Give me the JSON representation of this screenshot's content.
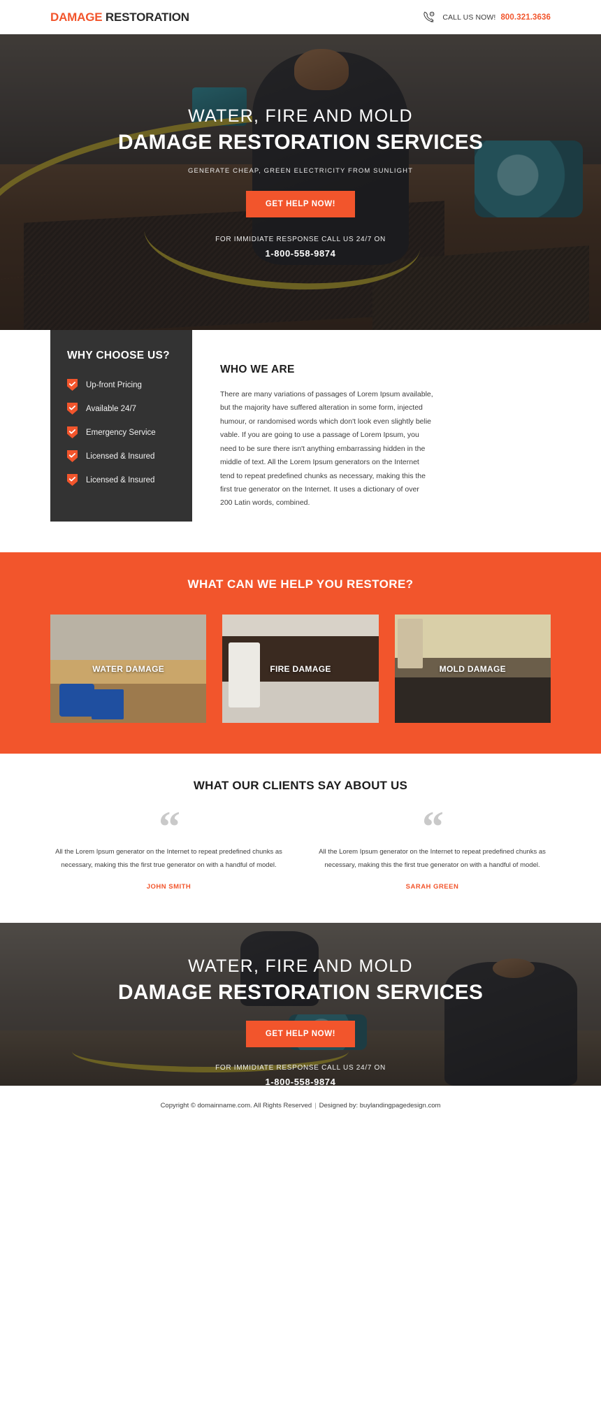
{
  "header": {
    "logo_accent": "DAMAGE",
    "logo_rest": " RESTORATION",
    "phone_icon": "phone-24h-icon",
    "call_label": "CALL US NOW!",
    "call_number": "800.321.3636"
  },
  "hero": {
    "subtitle": "WATER, FIRE AND MOLD",
    "title": "DAMAGE RESTORATION SERVICES",
    "tagline": "GENERATE CHEAP, GREEN ELECTRICITY FROM SUNLIGHT",
    "cta_label": "GET HELP NOW!",
    "call_text": "FOR IMMIDIATE RESPONSE CALL US 24/7 ON",
    "call_number": "1-800-558-9874"
  },
  "why_choose": {
    "title": "WHY CHOOSE US?",
    "icon": "check-shield-icon",
    "items": [
      {
        "label": "Up-front Pricing"
      },
      {
        "label": "Available 24/7"
      },
      {
        "label": "Emergency Service"
      },
      {
        "label": "Licensed & Insured"
      },
      {
        "label": "Licensed & Insured"
      }
    ]
  },
  "who_we_are": {
    "title": "WHO WE ARE",
    "body": "There are many variations of passages of Lorem Ipsum available, but the majority have suffered alteration in some form, injected humour, or randomised words which don't look even slightly belie vable. If you are going to use a passage of Lorem Ipsum, you need to be sure there isn't anything embarrassing hidden in the middle of text. All the Lorem Ipsum generators on the Internet tend to repeat predefined chunks as necessary, making this the first true generator on the Internet. It uses a dictionary of over 200 Latin words, combined."
  },
  "services": {
    "title": "WHAT CAN WE HELP YOU RESTORE?",
    "cards": [
      {
        "label": "WATER DAMAGE",
        "image": "water-damage-photo"
      },
      {
        "label": "FIRE DAMAGE",
        "image": "fire-damage-photo"
      },
      {
        "label": "MOLD DAMAGE",
        "image": "mold-damage-photo"
      }
    ]
  },
  "testimonials": {
    "title": "WHAT OUR CLIENTS SAY ABOUT US",
    "quote_glyph": "“",
    "items": [
      {
        "text": "All the Lorem Ipsum generator on the Internet to repeat predefined chunks as necessary, making this the first true generator on with a handful of model.",
        "name": "JOHN SMITH"
      },
      {
        "text": "All the Lorem Ipsum generator on the Internet to repeat predefined chunks as necessary, making this the first true generator on with a handful of model.",
        "name": "SARAH GREEN"
      }
    ]
  },
  "bottom_cta": {
    "subtitle": "WATER, FIRE AND MOLD",
    "title": "DAMAGE RESTORATION SERVICES",
    "cta_label": "GET HELP NOW!",
    "call_text": "FOR IMMIDIATE RESPONSE CALL US 24/7 ON",
    "call_number": "1-800-558-9874"
  },
  "footer": {
    "copyright": "Copyright © domainname.com. All Rights Reserved",
    "separator": "|",
    "designed_by": "Designed by:",
    "designer_link": "buylandingpagedesign.com"
  },
  "colors": {
    "accent": "#f2552c",
    "dark_panel": "#333333",
    "text_dark": "#1d1d1d"
  }
}
